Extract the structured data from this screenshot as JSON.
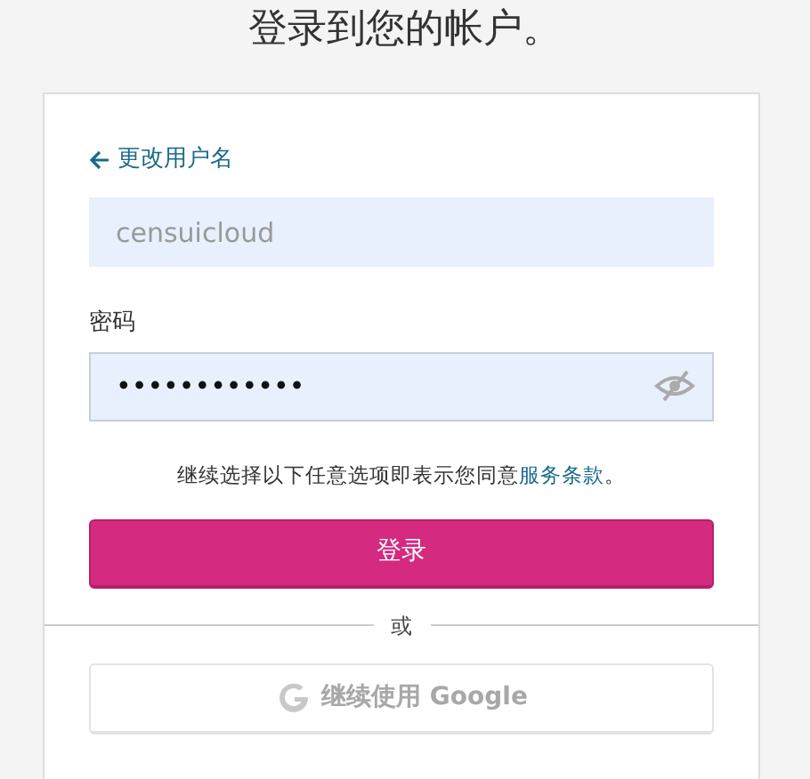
{
  "title": "登录到您的帐户。",
  "back_link": "更改用户名",
  "username": {
    "value": "censuicloud",
    "disabled": true
  },
  "password": {
    "label": "密码",
    "value": "••••••••••••",
    "revealed": false
  },
  "terms": {
    "text": "继续选择以下任意选项即表示您同意",
    "link": "服务条款",
    "suffix": "。"
  },
  "submit": "登录",
  "divider": "或",
  "google_button": {
    "label": "继续使用 Google",
    "disabled": true
  }
}
